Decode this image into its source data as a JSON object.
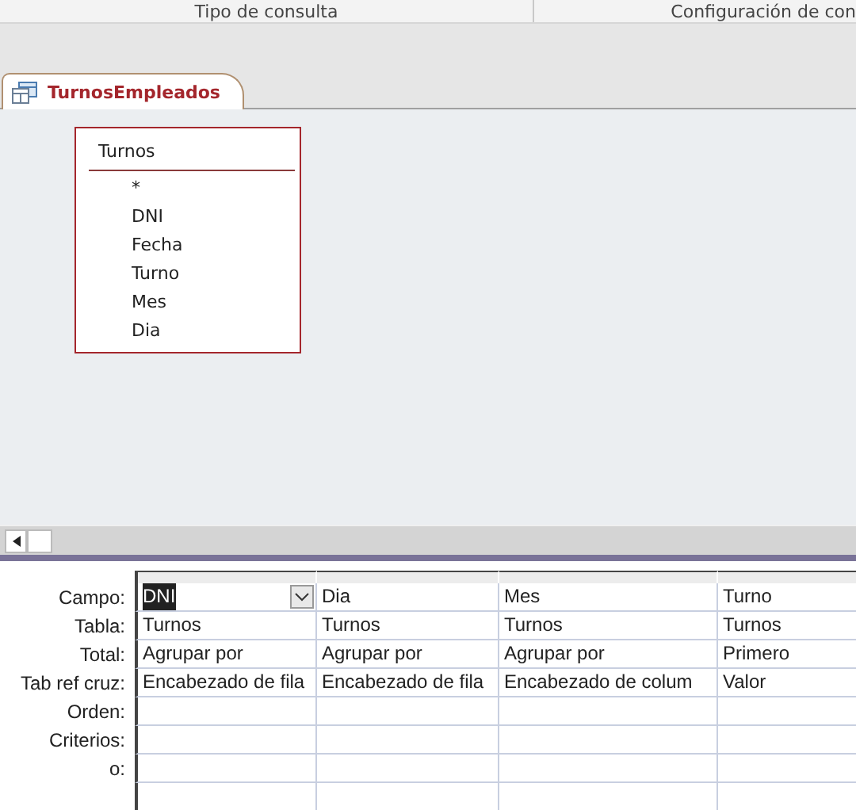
{
  "ribbon_groups": [
    "Tipo de consulta",
    "Configuración de con"
  ],
  "document_tab": {
    "label": "TurnosEmpleados",
    "selected": true
  },
  "table_box": {
    "title": "Turnos",
    "fields": [
      "*",
      "DNI",
      "Fecha",
      "Turno",
      "Mes",
      "Dia"
    ]
  },
  "grid": {
    "row_labels": [
      "Campo:",
      "Tabla:",
      "Total:",
      "Tab ref cruz:",
      "Orden:",
      "Criterios:",
      "o:"
    ],
    "columns": [
      {
        "field": "DNI",
        "selected": true,
        "table": "Turnos",
        "total": "Agrupar por",
        "crosstab": "Encabezado de fila"
      },
      {
        "field": "Dia",
        "selected": false,
        "table": "Turnos",
        "total": "Agrupar por",
        "crosstab": "Encabezado de fila"
      },
      {
        "field": "Mes",
        "selected": false,
        "table": "Turnos",
        "total": "Agrupar por",
        "crosstab": "Encabezado de colum"
      },
      {
        "field": "Turno",
        "selected": false,
        "table": "Turnos",
        "total": "Primero",
        "crosstab": "Valor"
      }
    ]
  }
}
